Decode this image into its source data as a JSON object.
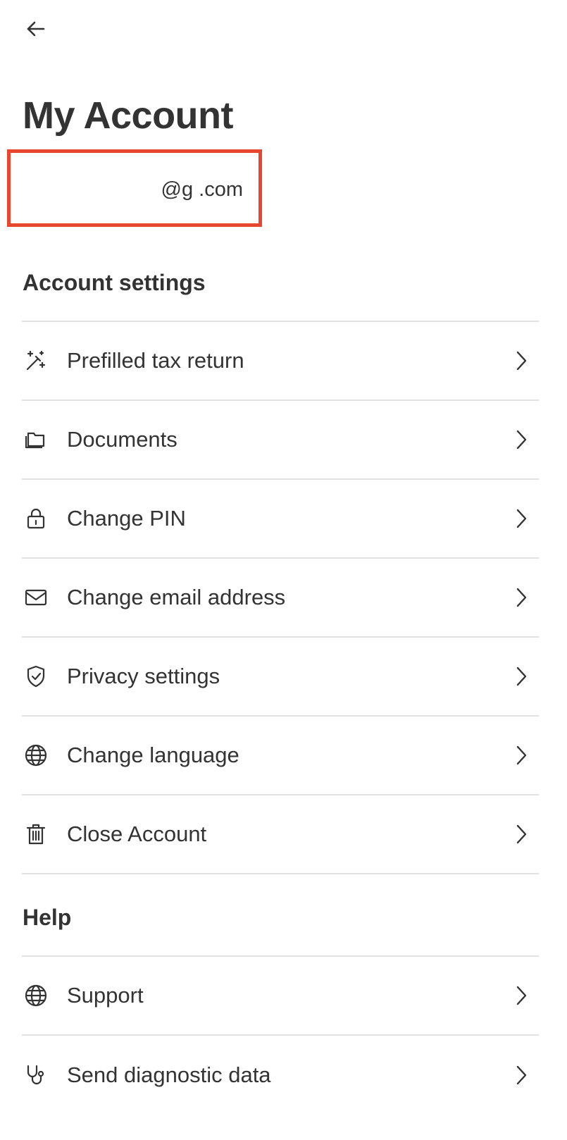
{
  "header": {
    "back_icon": "arrow-left-icon",
    "title": "My Account",
    "email": "@g .com"
  },
  "account_settings": {
    "title": "Account settings",
    "items": [
      {
        "label": "Prefilled tax return",
        "icon": "magic-wand-icon"
      },
      {
        "label": "Documents",
        "icon": "folder-icon"
      },
      {
        "label": "Change PIN",
        "icon": "lock-icon"
      },
      {
        "label": "Change email address",
        "icon": "envelope-icon"
      },
      {
        "label": "Privacy settings",
        "icon": "shield-check-icon"
      },
      {
        "label": "Change language",
        "icon": "globe-icon"
      },
      {
        "label": "Close Account",
        "icon": "trash-icon"
      }
    ]
  },
  "help": {
    "title": "Help",
    "items": [
      {
        "label": "Support",
        "icon": "globe-icon"
      },
      {
        "label": "Send diagnostic data",
        "icon": "stethoscope-icon"
      }
    ]
  },
  "colors": {
    "text": "#333333",
    "divider": "#e2e2e2",
    "highlight_border": "#e8472f"
  }
}
